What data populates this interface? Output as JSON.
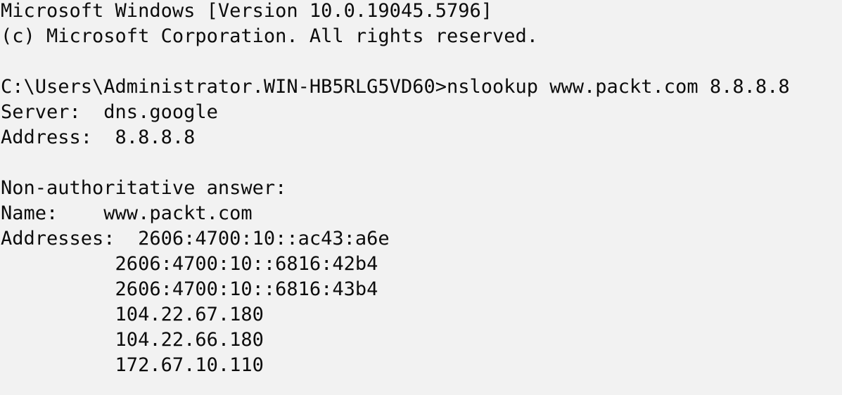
{
  "console": {
    "lines": [
      "Microsoft Windows [Version 10.0.19045.5796]",
      "(c) Microsoft Corporation. All rights reserved.",
      "",
      "C:\\Users\\Administrator.WIN-HB5RLG5VD60>nslookup www.packt.com 8.8.8.8",
      "Server:  dns.google",
      "Address:  8.8.8.8",
      "",
      "Non-authoritative answer:",
      "Name:    www.packt.com",
      "Addresses:  2606:4700:10::ac43:a6e",
      "          2606:4700:10::6816:42b4",
      "          2606:4700:10::6816:43b4",
      "          104.22.67.180",
      "          104.22.66.180",
      "          172.67.10.110"
    ]
  }
}
